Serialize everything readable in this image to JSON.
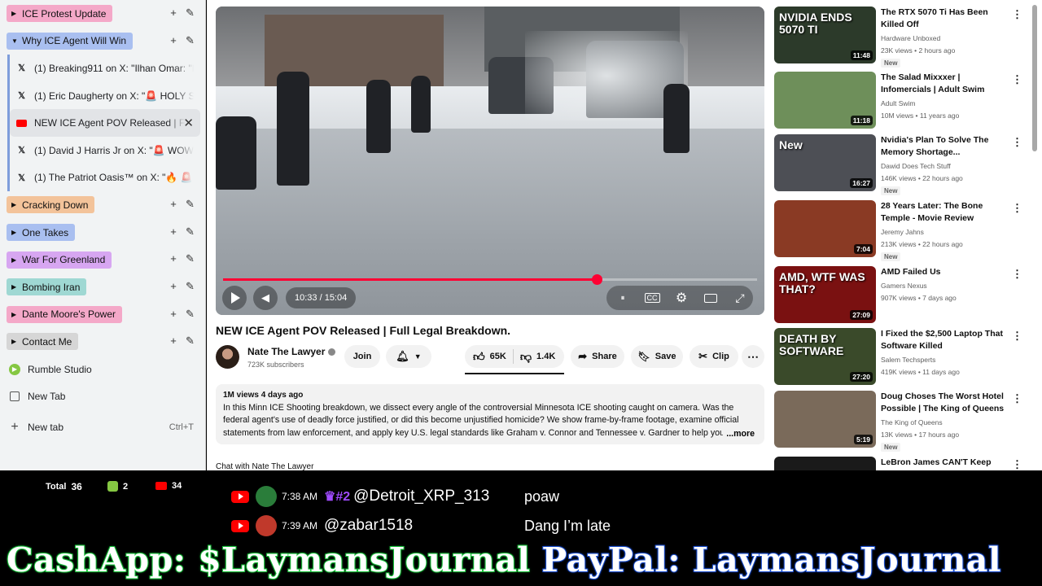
{
  "sidebar": {
    "groups": [
      {
        "label": "ICE Protest Update",
        "color": "#f4a8c8",
        "expanded": false
      },
      {
        "label": "Why ICE Agent Will Win",
        "color": "#a9bff0",
        "expanded": true
      },
      {
        "label": "Cracking Down",
        "color": "#f3c39a",
        "expanded": false
      },
      {
        "label": "One Takes",
        "color": "#a9bff0",
        "expanded": false
      },
      {
        "label": "War For Greenland",
        "color": "#d7a6f1",
        "expanded": false
      },
      {
        "label": "Bombing Iran",
        "color": "#9fd8d3",
        "expanded": false
      },
      {
        "label": "Dante Moore's Power",
        "color": "#f4a8c8",
        "expanded": false
      },
      {
        "label": "Contact Me",
        "color": "#d6d6d6",
        "expanded": false
      }
    ],
    "tabs": [
      {
        "title": "(1) Breaking911 on X: \"Ilhan Omar: \"He",
        "icon": "x-icon"
      },
      {
        "title": "(1) Eric Daugherty on X: \"🚨 HOLY SMO",
        "icon": "x-icon"
      },
      {
        "title": "NEW ICE Agent POV Released | Full L",
        "icon": "youtube-icon",
        "active": true
      },
      {
        "title": "(1) David J Harris Jr on X: \"🚨 WOW! Re",
        "icon": "x-icon"
      },
      {
        "title": "(1) The Patriot Oasis™ on X: \"🔥 🚨 COI",
        "icon": "x-icon"
      }
    ],
    "misc": {
      "rumble": "Rumble Studio",
      "new_tab_1": "New Tab",
      "new_tab_2": "New tab",
      "shortcut": "Ctrl+T"
    }
  },
  "player": {
    "time": "10:33 / 15:04",
    "progress": 0.7
  },
  "video": {
    "title": "NEW ICE Agent POV Released | Full Legal Breakdown.",
    "channel": "Nate The Lawyer",
    "subscribers": "723K subscribers",
    "join": "Join",
    "likes": "65K",
    "dislikes": "1.4K",
    "share": "Share",
    "save": "Save",
    "clip": "Clip",
    "meta": "1M views  4 days ago",
    "description": "In this Minn ICE Shooting breakdown, we dissect every angle of the controversial Minnesota ICE shooting caught on camera. Was the federal agent's use of deadly force justified, or did this become unjustified homicide? We show frame-by-frame footage, examine official statements from law enforcement, and apply key U.S. legal standards like Graham v. Connor and Tennessee v. Gardner to help you decide for your",
    "more": "...more",
    "cut_off": "Chat with Nate The Lawyer"
  },
  "related": [
    {
      "title": "The RTX 5070 Ti Has Been Killed Off",
      "channel": "Hardware Unboxed",
      "meta": "23K views • 2 hours ago",
      "duration": "11:48",
      "new": "New",
      "thumb_text": "NVIDIA ENDS 5070 TI",
      "thumb_color": "#2c3a2a"
    },
    {
      "title": "The Salad Mixxxer | Infomercials | Adult Swim",
      "channel": "Adult Swim",
      "meta": "10M views • 11 years ago",
      "duration": "11:18",
      "new": "",
      "thumb_text": "",
      "thumb_color": "#6e8f5a"
    },
    {
      "title": "Nvidia's Plan To Solve The Memory Shortage...",
      "channel": "Dawid Does Tech Stuff",
      "meta": "146K views • 22 hours ago",
      "duration": "16:27",
      "new": "New",
      "thumb_text": "New",
      "thumb_color": "#4d4f55"
    },
    {
      "title": "28 Years Later: The Bone Temple - Movie Review",
      "channel": "Jeremy Jahns",
      "meta": "213K views • 22 hours ago",
      "duration": "7:04",
      "new": "New",
      "thumb_text": "",
      "thumb_color": "#8a3a24"
    },
    {
      "title": "AMD Failed Us",
      "channel": "Gamers Nexus",
      "meta": "907K views • 7 days ago",
      "duration": "27:09",
      "new": "",
      "thumb_text": "AMD, WTF WAS THAT?",
      "thumb_color": "#7a1111"
    },
    {
      "title": "I Fixed the $2,500 Laptop That Software Killed",
      "channel": "Salem Techsperts",
      "meta": "419K views • 11 days ago",
      "duration": "27:20",
      "new": "",
      "thumb_text": "DEATH BY SOFTWARE",
      "thumb_color": "#3a4a2a"
    },
    {
      "title": "Doug Choses The Worst Hotel Possible | The King of Queens",
      "channel": "The King of Queens",
      "meta": "13K views • 17 hours ago",
      "duration": "5:19",
      "new": "New",
      "thumb_text": "",
      "thumb_color": "#7a6a5a"
    },
    {
      "title": "LeBron James CAN'T Keep",
      "channel": "",
      "meta": "",
      "duration": "",
      "new": "",
      "thumb_text": "",
      "thumb_color": "#1a1a1a"
    }
  ],
  "overlay": {
    "total_label": "Total",
    "total": "36",
    "rumble_count": "2",
    "youtube_count": "34",
    "chat": [
      {
        "time": "7:38 AM",
        "badge": "#2",
        "user": "@Detroit_XRP_313",
        "message": "poaw",
        "avatar_color": "#2a7d3a"
      },
      {
        "time": "7:39 AM",
        "badge": "",
        "user": "@zabar1518",
        "message": "Dang I’m late",
        "avatar_color": "#c0392b"
      }
    ],
    "donate_cashapp": "CashApp: $LaymansJournal",
    "donate_paypal": "PayPal: LaymansJournal"
  }
}
